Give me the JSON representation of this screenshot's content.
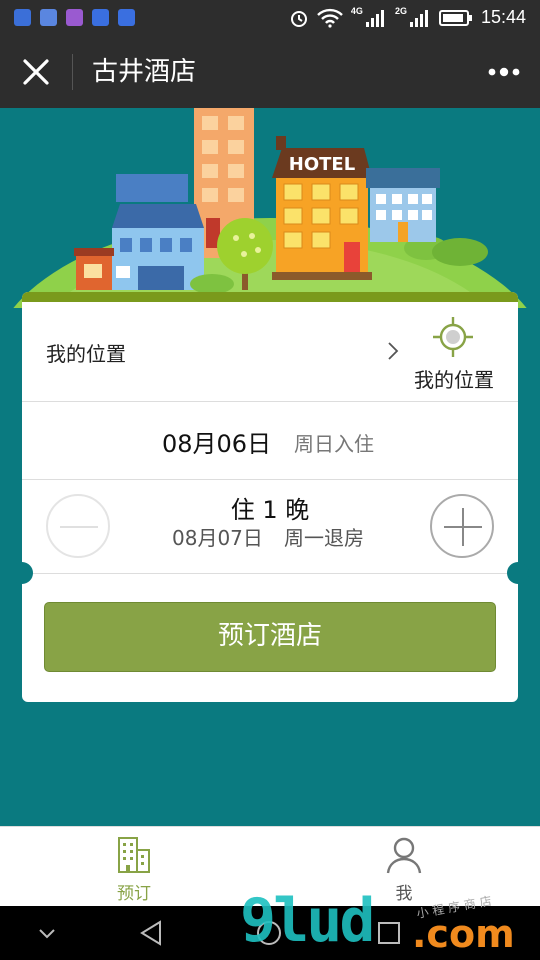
{
  "status_bar": {
    "network_4g": "4G",
    "network_2g": "2G",
    "time": "15:44",
    "icons": [
      "shield-icon",
      "app-icon",
      "gallery-icon",
      "baidu-paw-icon",
      "baidu-paw-icon",
      "alarm-icon",
      "wifi-icon",
      "signal-icon",
      "signal-icon",
      "battery-icon"
    ]
  },
  "titlebar": {
    "title": "古井酒店",
    "close_icon": "close-icon",
    "more_icon": "more-dots-icon"
  },
  "hero": {
    "hotel_sign": "HOTEL"
  },
  "booking": {
    "location_label": "我的位置",
    "locate_button_label": "我的位置",
    "checkin_date": "08月06日",
    "checkin_label": "周日入住",
    "nights_label": "住 1 晚",
    "checkout_date": "08月07日",
    "checkout_label": "周一退房",
    "book_button": "预订酒店"
  },
  "tabbar": {
    "tabs": [
      {
        "label": "预订",
        "icon": "building-icon",
        "active": true
      },
      {
        "label": "我",
        "icon": "person-icon",
        "active": false
      }
    ]
  },
  "watermark": {
    "main": "9lud",
    "domain": ".com",
    "tagline": "小程序商店"
  },
  "colors": {
    "accent": "#88a346",
    "background": "#0a7a80",
    "topbar": "#2d2d2d"
  }
}
